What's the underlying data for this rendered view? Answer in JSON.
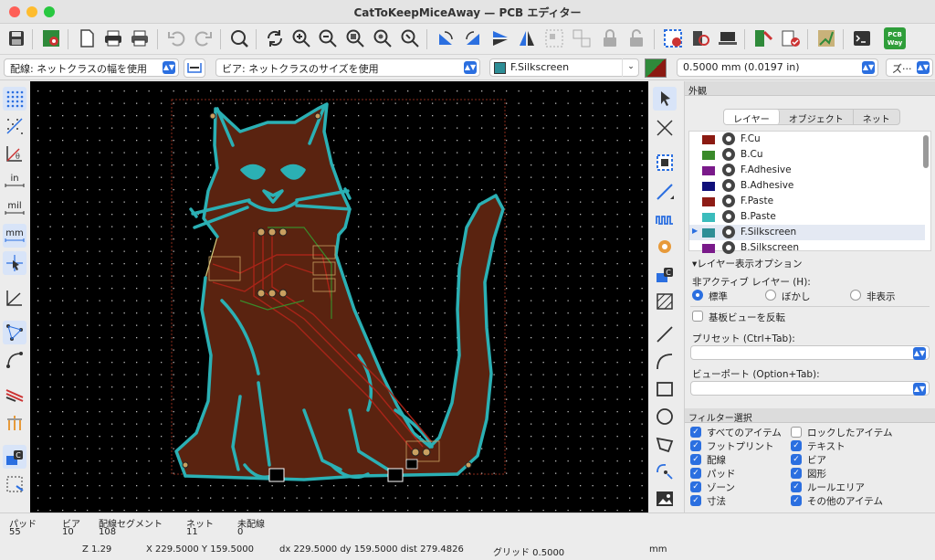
{
  "window": {
    "title": "CatToKeepMiceAway — PCB エディター"
  },
  "options": {
    "track": "配線: ネットクラスの幅を使用",
    "via": "ビア: ネットクラスのサイズを使用",
    "layer": "F.Silkscreen",
    "grid": "0.5000 mm (0.0197 in)",
    "zoom": "ズ···"
  },
  "units": {
    "in": "in",
    "mil": "mil",
    "mm": "mm"
  },
  "panel": {
    "appearance_title": "外観",
    "tabs": [
      "レイヤー",
      "オブジェクト",
      "ネット"
    ],
    "layers": [
      {
        "name": "F.Cu",
        "color": "#8b1a12"
      },
      {
        "name": "B.Cu",
        "color": "#3a8a2a"
      },
      {
        "name": "F.Adhesive",
        "color": "#7a1a8a"
      },
      {
        "name": "B.Adhesive",
        "color": "#10107a"
      },
      {
        "name": "F.Paste",
        "color": "#8e1c16"
      },
      {
        "name": "B.Paste",
        "color": "#3bbcbc"
      },
      {
        "name": "F.Silkscreen",
        "color": "#2e8e96"
      },
      {
        "name": "B.Silkscreen",
        "color": "#7a1a8a"
      }
    ],
    "layer_display_options": "レイヤー表示オプション",
    "inactive_layers": "非アクティブ レイヤー (H):",
    "inactive_opts": [
      "標準",
      "ぼかし",
      "非表示"
    ],
    "flip_board": "基板ビューを反転",
    "presets": "プリセット (Ctrl+Tab):",
    "viewports": "ビューポート (Option+Tab):",
    "filter_title": "フィルター選択",
    "filters_left": [
      "すべてのアイテム",
      "フットプリント",
      "配線",
      "パッド",
      "ゾーン",
      "寸法"
    ],
    "filters_right": [
      "ロックしたアイテム",
      "テキスト",
      "ビア",
      "図形",
      "ルールエリア",
      "その他のアイテム"
    ]
  },
  "status": {
    "pads_label": "パッド",
    "pads": "55",
    "vias_label": "ビア",
    "vias": "10",
    "segments_label": "配線セグメント",
    "segments": "108",
    "nets_label": "ネット",
    "nets": "11",
    "unrouted_label": "未配線",
    "unrouted": "0",
    "zoom": "Z 1.29",
    "xy": "X 229.5000  Y 159.5000",
    "delta": "dx 229.5000  dy 159.5000  dist 279.4826",
    "grid": "グリッド 0.5000",
    "units": "mm"
  },
  "canvas": {
    "pcbway_text": "PCB Way"
  }
}
